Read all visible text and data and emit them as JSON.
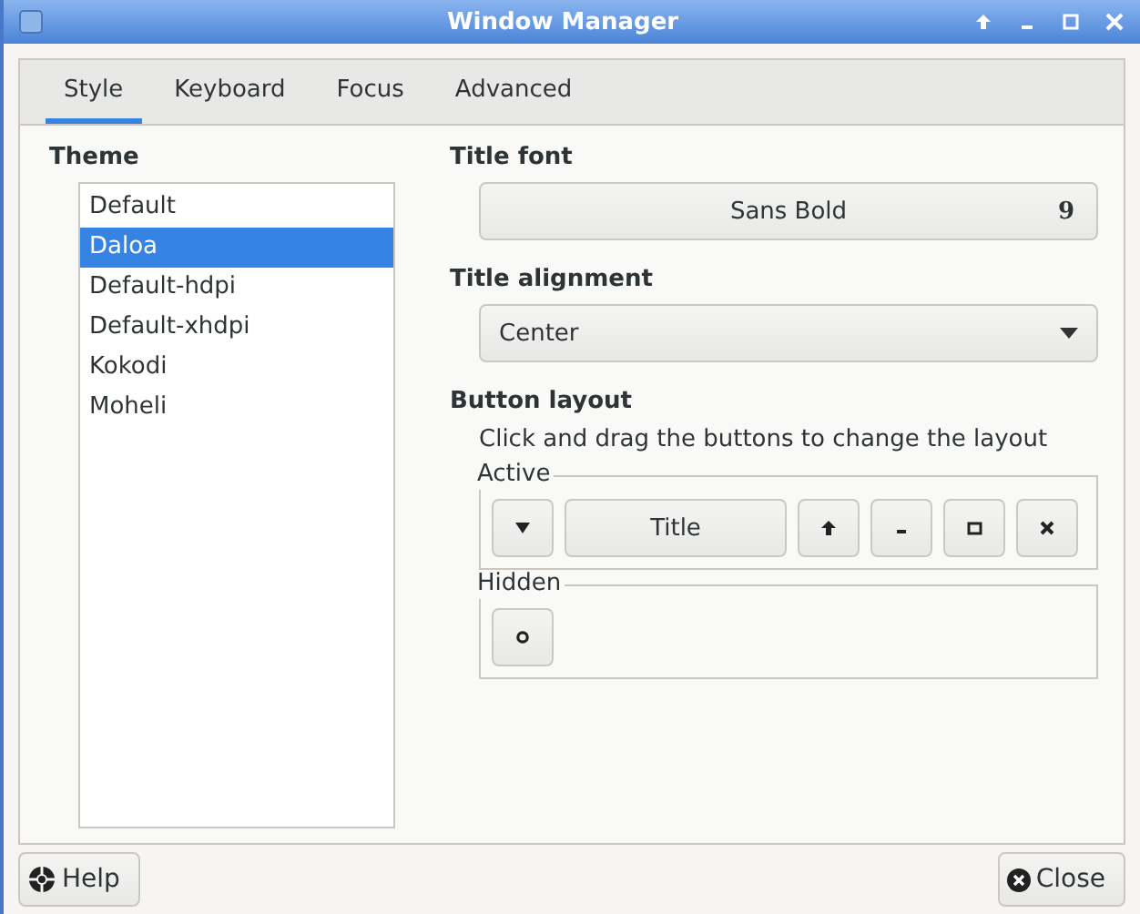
{
  "window": {
    "title": "Window Manager"
  },
  "tabs": [
    {
      "label": "Style",
      "selected": true
    },
    {
      "label": "Keyboard",
      "selected": false
    },
    {
      "label": "Focus",
      "selected": false
    },
    {
      "label": "Advanced",
      "selected": false
    }
  ],
  "theme": {
    "heading": "Theme",
    "items": [
      {
        "label": "Default",
        "selected": false
      },
      {
        "label": "Daloa",
        "selected": true
      },
      {
        "label": "Default-hdpi",
        "selected": false
      },
      {
        "label": "Default-xhdpi",
        "selected": false
      },
      {
        "label": "Kokodi",
        "selected": false
      },
      {
        "label": "Moheli",
        "selected": false
      }
    ]
  },
  "title_font": {
    "heading": "Title font",
    "font": "Sans Bold",
    "size": "9"
  },
  "title_alignment": {
    "heading": "Title alignment",
    "value": "Center"
  },
  "button_layout": {
    "heading": "Button layout",
    "hint": "Click and drag the buttons to change the layout",
    "active": {
      "label": "Active",
      "buttons": [
        {
          "kind": "menu"
        },
        {
          "kind": "title",
          "label": "Title"
        },
        {
          "kind": "shade"
        },
        {
          "kind": "minimize"
        },
        {
          "kind": "maximize"
        },
        {
          "kind": "close"
        }
      ]
    },
    "hidden": {
      "label": "Hidden",
      "buttons": [
        {
          "kind": "stick"
        }
      ]
    }
  },
  "buttons": {
    "help": "Help",
    "close": "Close"
  }
}
